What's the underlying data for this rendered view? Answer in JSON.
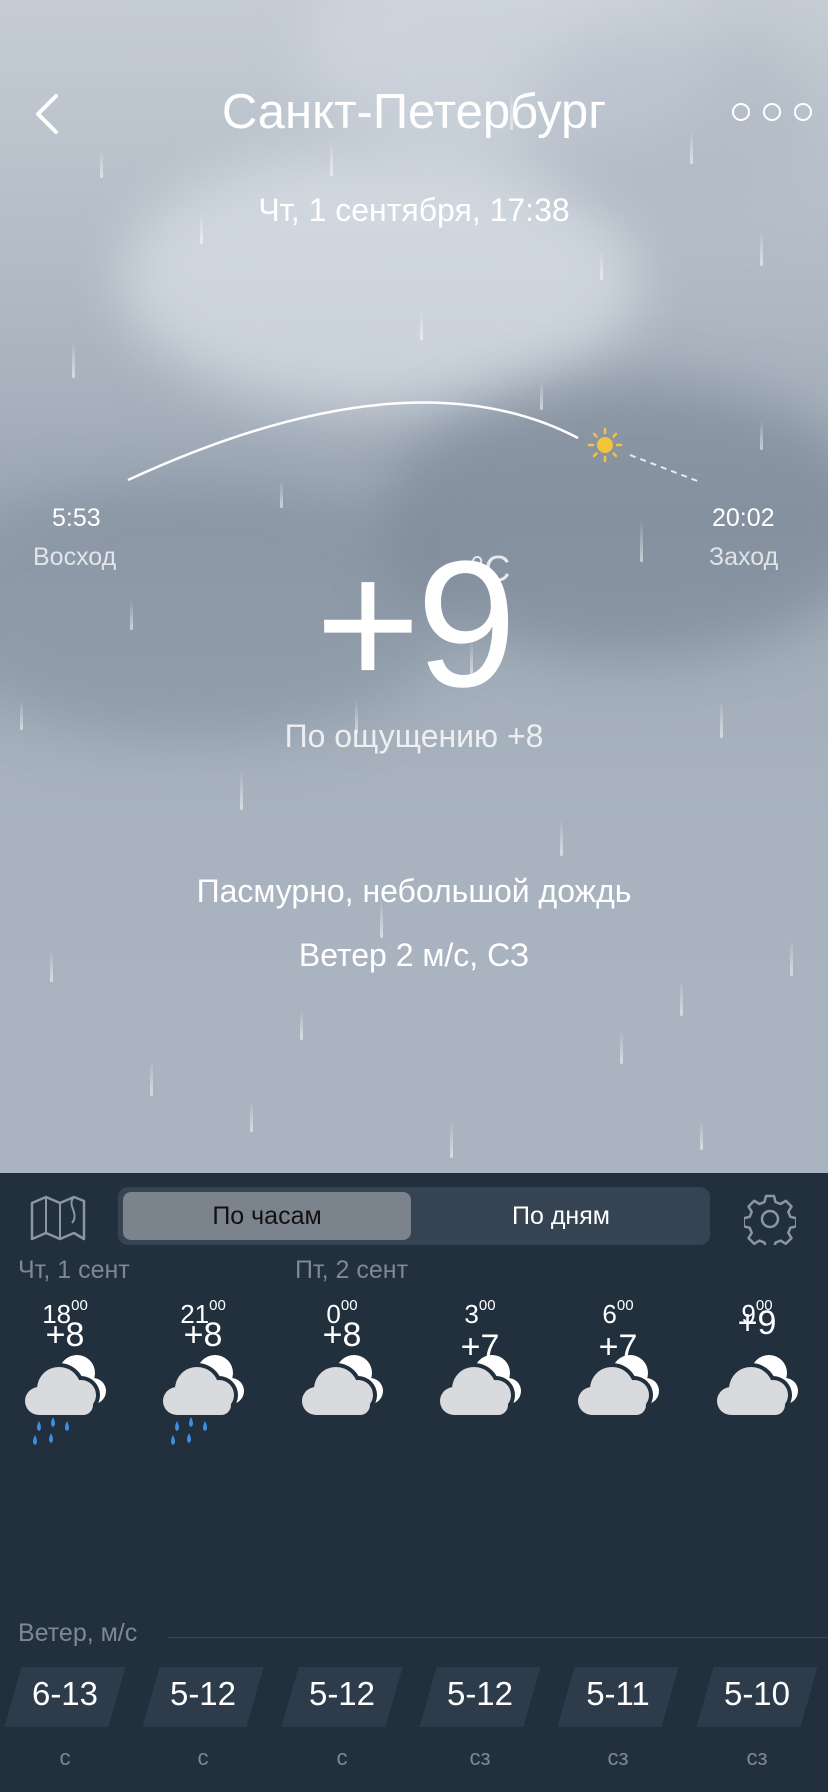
{
  "header": {
    "city": "Санкт-Петербург",
    "datetime": "Чт, 1 сентября, 17:38"
  },
  "sun": {
    "sunrise_time": "5:53",
    "sunrise_label": "Восход",
    "sunset_time": "20:02",
    "sunset_label": "Заход"
  },
  "current": {
    "temperature": "+9",
    "unit": "°C",
    "feels_like": "По ощущению +8",
    "condition": "Пасмурно, небольшой дождь",
    "wind": "Ветер 2 м/с, СЗ"
  },
  "tabs": {
    "hourly": "По часам",
    "daily": "По дням",
    "active": "hourly"
  },
  "forecast": {
    "day_labels": [
      "Чт, 1 сент",
      "Пт, 2 сент"
    ],
    "hours": [
      {
        "hour": "18",
        "min": "00",
        "icon": "cloud-rain-icon",
        "temp": "+8",
        "wind": "6-13",
        "dir": "с"
      },
      {
        "hour": "21",
        "min": "00",
        "icon": "cloud-rain-icon",
        "temp": "+8",
        "wind": "5-12",
        "dir": "с"
      },
      {
        "hour": "0",
        "min": "00",
        "icon": "cloudy-icon",
        "temp": "+8",
        "wind": "5-12",
        "dir": "с"
      },
      {
        "hour": "3",
        "min": "00",
        "icon": "cloudy-icon",
        "temp": "+7",
        "wind": "5-12",
        "dir": "сз"
      },
      {
        "hour": "6",
        "min": "00",
        "icon": "cloudy-icon",
        "temp": "+7",
        "wind": "5-11",
        "dir": "сз"
      },
      {
        "hour": "9",
        "min": "00",
        "icon": "cloudy-icon",
        "temp": "+9",
        "wind": "5-10",
        "dir": "сз"
      }
    ],
    "wind_title": "Ветер, м/с"
  },
  "colors": {
    "panel_bg": "#22303e",
    "temp_line": "#8fd14f",
    "rain_drops": "#3d8ee6",
    "sun": "#f2c43a"
  }
}
